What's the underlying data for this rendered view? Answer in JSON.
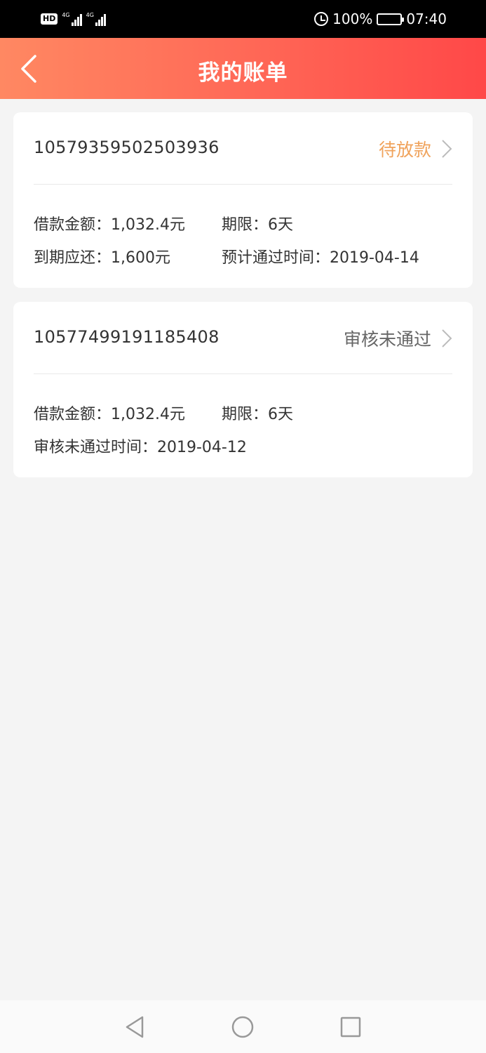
{
  "status_bar": {
    "hd": "HD",
    "network_1": "4G",
    "network_2": "4G",
    "battery": "100%",
    "time": "07:40",
    "battery_level": 1.0
  },
  "header": {
    "title": "我的账单",
    "back_icon": "chevron-left-icon"
  },
  "bills": [
    {
      "order_no": "10579359502503936",
      "status": "待放款",
      "status_color": "#f0a35c",
      "amount_text": "借款金额：1,032.4元",
      "term_text": "期限：6天",
      "repay_text": "到期应还：1,600元",
      "date_text": "预计通过时间：2019-04-14"
    },
    {
      "order_no": "10577499191185408",
      "status": "审核未通过",
      "status_color": "#666666",
      "amount_text": "借款金额：1,032.4元",
      "term_text": "期限：6天",
      "date_text": "审核未通过时间：2019-04-12"
    }
  ],
  "colors": {
    "header_start": "#ff8862",
    "header_end": "#ff4848",
    "background": "#f4f4f4"
  },
  "nav_bar": {
    "back_icon": "triangle-back-icon",
    "home_icon": "circle-home-icon",
    "recent_icon": "square-recent-icon"
  }
}
